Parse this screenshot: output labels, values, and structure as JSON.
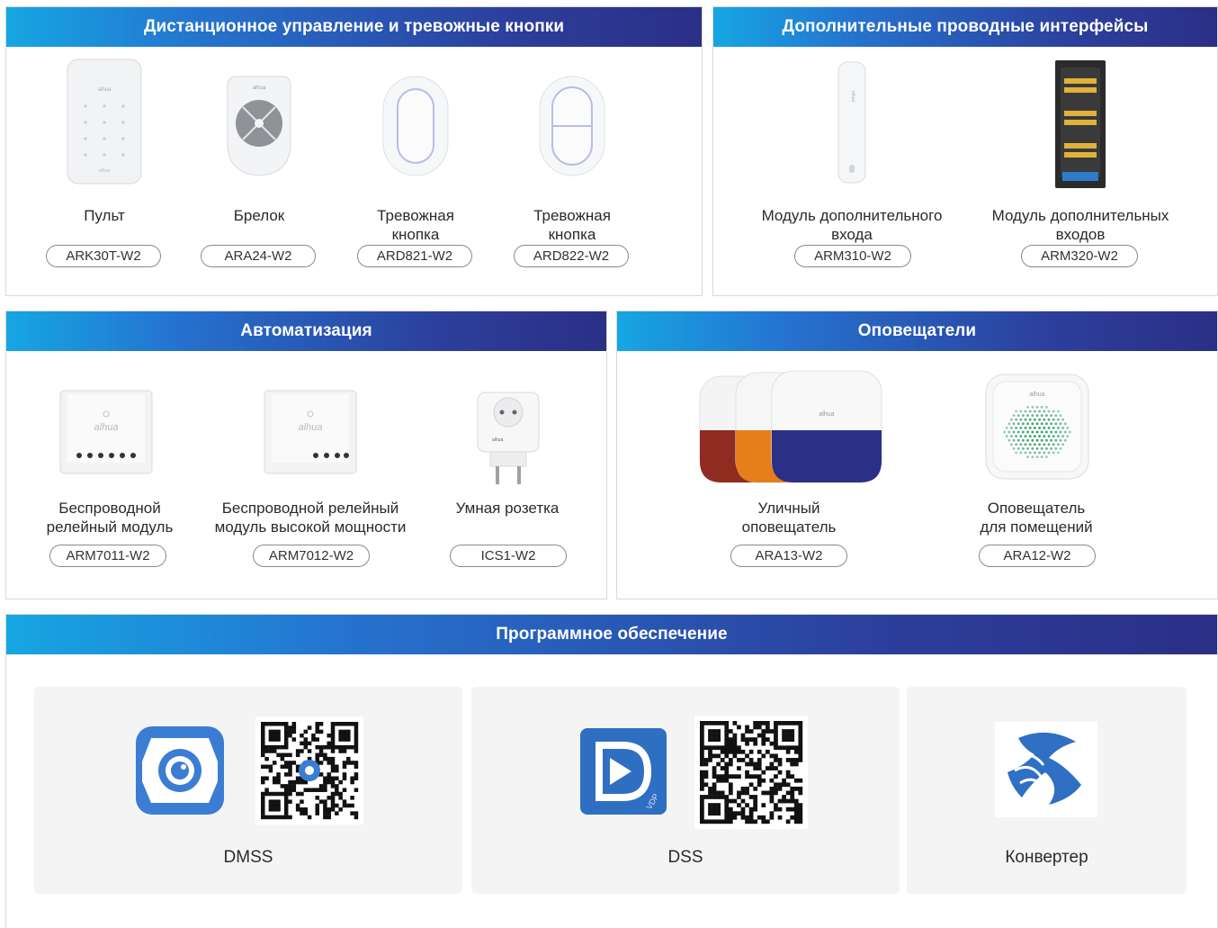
{
  "sections": {
    "remote": {
      "title": "Дистанционное управление и тревожные кнопки",
      "items": [
        {
          "label": "Пульт",
          "model": "ARK30T-W2"
        },
        {
          "label": "Брелок",
          "model": "ARA24-W2"
        },
        {
          "label": "Тревожная\nкнопка",
          "model": "ARD821-W2"
        },
        {
          "label": "Тревожная\nкнопка",
          "model": "ARD822-W2"
        }
      ]
    },
    "wired": {
      "title": "Дополнительные проводные интерфейсы",
      "items": [
        {
          "label": "Модуль дополнительного\nвхода",
          "model": "ARM310-W2"
        },
        {
          "label": "Модуль дополнительных\nвходов",
          "model": "ARM320-W2"
        }
      ]
    },
    "automation": {
      "title": "Автоматизация",
      "items": [
        {
          "label": "Беспроводной\nрелейный модуль",
          "model": "ARM7011-W2"
        },
        {
          "label": "Беспроводной релейный\nмодуль высокой мощности",
          "model": "ARM7012-W2"
        },
        {
          "label": "Умная розетка",
          "model": "ICS1-W2"
        }
      ]
    },
    "sirens": {
      "title": "Оповещатели",
      "items": [
        {
          "label": "Уличный\nоповещатель",
          "model": "ARA13-W2"
        },
        {
          "label": "Оповещатель\nдля помещений",
          "model": "ARA12-W2"
        }
      ]
    },
    "software": {
      "title": "Программное обеспечение",
      "items": [
        {
          "name": "DMSS",
          "icon": "dmss-app-icon"
        },
        {
          "name": "DSS",
          "icon": "dss-app-icon",
          "badge": "VDP"
        },
        {
          "name": "Конвертер",
          "icon": "converter-app-icon"
        }
      ]
    }
  },
  "colors": {
    "header_start": "#16a6e3",
    "header_end": "#2b2f86",
    "brand_blue": "#2f6fc4"
  }
}
